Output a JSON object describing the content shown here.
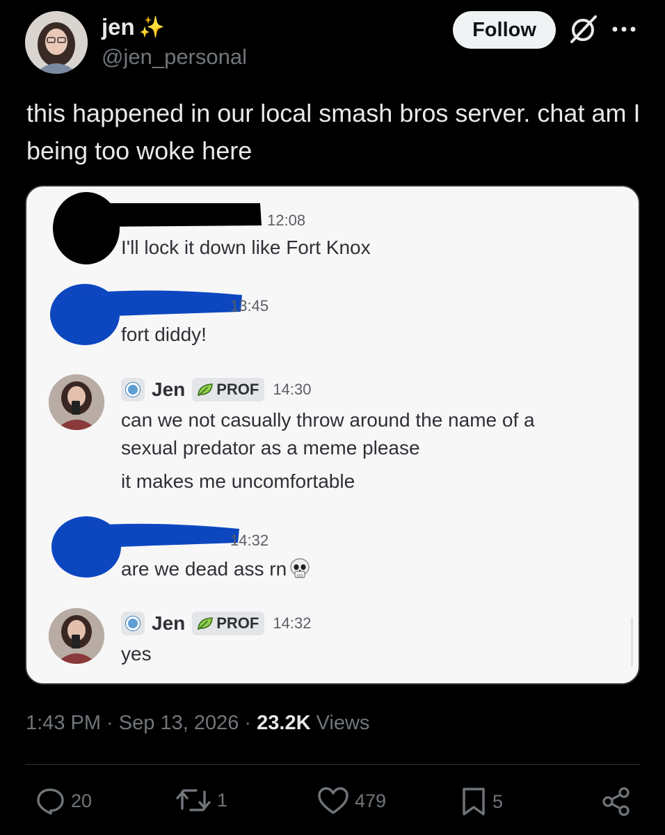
{
  "author": {
    "display_name": "jen",
    "emoji": "✨",
    "handle": "@jen_personal"
  },
  "header": {
    "follow_label": "Follow"
  },
  "tweet": {
    "text": "this happened in our local smash bros server. chat am I being too woke here"
  },
  "screenshot": {
    "messages": [
      {
        "time": "12:08",
        "text": "I'll lock it down like Fort Knox",
        "redacted_name": true
      },
      {
        "time": "13:45",
        "text": "fort diddy!",
        "redacted_name": true
      },
      {
        "author": "Jen",
        "tag": "PROF",
        "time": "14:30",
        "lines": [
          "can we not casually throw around the name of a",
          "sexual predator as a meme please",
          "it makes me uncomfortable"
        ]
      },
      {
        "time": "14:32",
        "text": "are we dead ass rn",
        "emoji": "💀",
        "redacted_name": true
      },
      {
        "author": "Jen",
        "tag": "PROF",
        "time": "14:32",
        "lines": [
          "yes"
        ]
      }
    ]
  },
  "meta": {
    "time": "1:43 PM",
    "sep": "·",
    "date": "Sep 13, 2026",
    "views_count": "23.2K",
    "views_label": "Views"
  },
  "actions": {
    "replies": "20",
    "reposts": "1",
    "likes": "479",
    "bookmarks": "5"
  },
  "colors": {
    "background": "#000000",
    "text": "#e7e9ea",
    "muted": "#71767b",
    "redaction_black": "#000000",
    "redaction_blue": "#0d47c0"
  },
  "icons": [
    "grok-icon",
    "more-icon",
    "reply-icon",
    "repost-icon",
    "like-icon",
    "bookmark-icon",
    "share-icon",
    "leaf-icon",
    "skull-icon"
  ]
}
